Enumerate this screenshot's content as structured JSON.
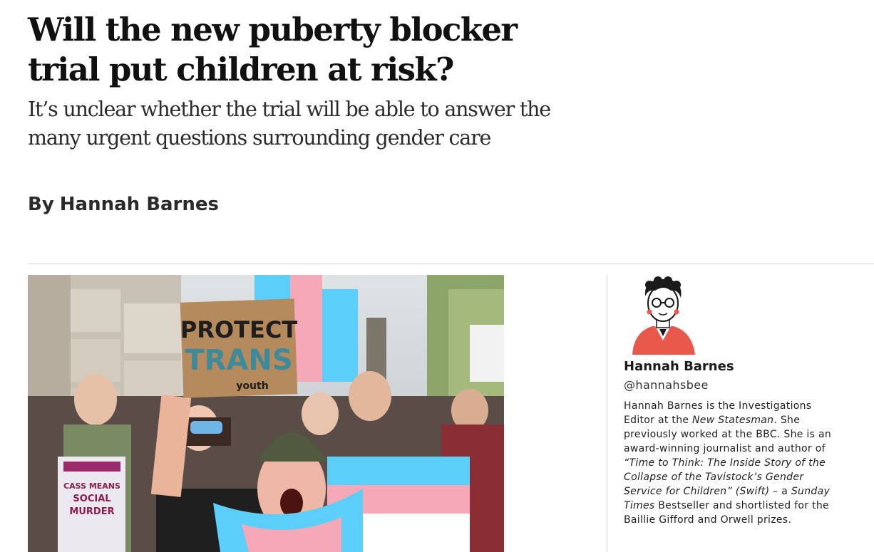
{
  "article": {
    "headline": "Will the new puberty blocker trial put children at risk?",
    "standfirst": "It’s unclear whether the trial will be able to answer the many urgent questions surrounding gender care",
    "byline_prefix": "By",
    "byline_author": "Hannah Barnes"
  },
  "hero_image": {
    "sign_line1": "PROTECT",
    "sign_line2": "TRANS",
    "sign_line3": "youth",
    "poster_text": "CASS MEANS SOCIAL MURDER"
  },
  "author_card": {
    "name": "Hannah Barnes",
    "handle": "@hannahsbee",
    "bio": {
      "p1": "Hannah Barnes is the Investigations Editor at the ",
      "i1": "New Statesman",
      "p2": ". She previously worked at the BBC. She is an award-winning journalist and author of ",
      "i2": "“Time to Think: The Inside Story of the Collapse of the Tavistock’s Gender Service for Children” (Swift)",
      "p3": " – a ",
      "i3": "Sunday Times",
      "p4": " Bestseller and shortlisted for the Baillie Gifford and Orwell prizes."
    }
  },
  "colors": {
    "trans_blue": "#5bcefa",
    "trans_pink": "#f5a9b8",
    "portrait_red": "#e8594b"
  }
}
